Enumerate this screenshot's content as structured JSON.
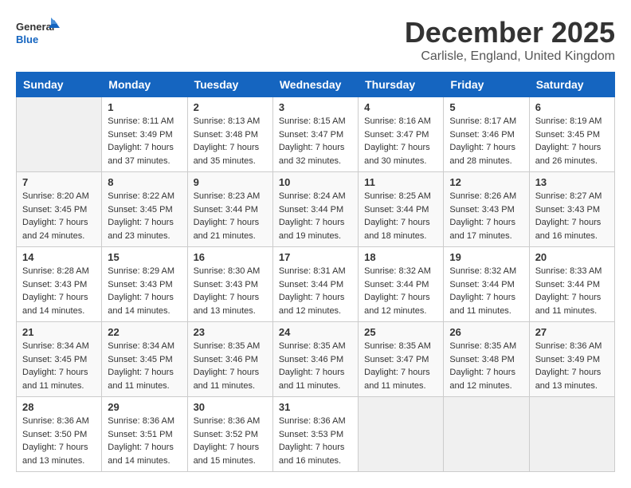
{
  "header": {
    "logo_general": "General",
    "logo_blue": "Blue",
    "month": "December 2025",
    "location": "Carlisle, England, United Kingdom"
  },
  "weekdays": [
    "Sunday",
    "Monday",
    "Tuesday",
    "Wednesday",
    "Thursday",
    "Friday",
    "Saturday"
  ],
  "weeks": [
    [
      {
        "day": "",
        "sunrise": "",
        "sunset": "",
        "daylight": ""
      },
      {
        "day": "1",
        "sunrise": "Sunrise: 8:11 AM",
        "sunset": "Sunset: 3:49 PM",
        "daylight": "Daylight: 7 hours and 37 minutes."
      },
      {
        "day": "2",
        "sunrise": "Sunrise: 8:13 AM",
        "sunset": "Sunset: 3:48 PM",
        "daylight": "Daylight: 7 hours and 35 minutes."
      },
      {
        "day": "3",
        "sunrise": "Sunrise: 8:15 AM",
        "sunset": "Sunset: 3:47 PM",
        "daylight": "Daylight: 7 hours and 32 minutes."
      },
      {
        "day": "4",
        "sunrise": "Sunrise: 8:16 AM",
        "sunset": "Sunset: 3:47 PM",
        "daylight": "Daylight: 7 hours and 30 minutes."
      },
      {
        "day": "5",
        "sunrise": "Sunrise: 8:17 AM",
        "sunset": "Sunset: 3:46 PM",
        "daylight": "Daylight: 7 hours and 28 minutes."
      },
      {
        "day": "6",
        "sunrise": "Sunrise: 8:19 AM",
        "sunset": "Sunset: 3:45 PM",
        "daylight": "Daylight: 7 hours and 26 minutes."
      }
    ],
    [
      {
        "day": "7",
        "sunrise": "Sunrise: 8:20 AM",
        "sunset": "Sunset: 3:45 PM",
        "daylight": "Daylight: 7 hours and 24 minutes."
      },
      {
        "day": "8",
        "sunrise": "Sunrise: 8:22 AM",
        "sunset": "Sunset: 3:45 PM",
        "daylight": "Daylight: 7 hours and 23 minutes."
      },
      {
        "day": "9",
        "sunrise": "Sunrise: 8:23 AM",
        "sunset": "Sunset: 3:44 PM",
        "daylight": "Daylight: 7 hours and 21 minutes."
      },
      {
        "day": "10",
        "sunrise": "Sunrise: 8:24 AM",
        "sunset": "Sunset: 3:44 PM",
        "daylight": "Daylight: 7 hours and 19 minutes."
      },
      {
        "day": "11",
        "sunrise": "Sunrise: 8:25 AM",
        "sunset": "Sunset: 3:44 PM",
        "daylight": "Daylight: 7 hours and 18 minutes."
      },
      {
        "day": "12",
        "sunrise": "Sunrise: 8:26 AM",
        "sunset": "Sunset: 3:43 PM",
        "daylight": "Daylight: 7 hours and 17 minutes."
      },
      {
        "day": "13",
        "sunrise": "Sunrise: 8:27 AM",
        "sunset": "Sunset: 3:43 PM",
        "daylight": "Daylight: 7 hours and 16 minutes."
      }
    ],
    [
      {
        "day": "14",
        "sunrise": "Sunrise: 8:28 AM",
        "sunset": "Sunset: 3:43 PM",
        "daylight": "Daylight: 7 hours and 14 minutes."
      },
      {
        "day": "15",
        "sunrise": "Sunrise: 8:29 AM",
        "sunset": "Sunset: 3:43 PM",
        "daylight": "Daylight: 7 hours and 14 minutes."
      },
      {
        "day": "16",
        "sunrise": "Sunrise: 8:30 AM",
        "sunset": "Sunset: 3:43 PM",
        "daylight": "Daylight: 7 hours and 13 minutes."
      },
      {
        "day": "17",
        "sunrise": "Sunrise: 8:31 AM",
        "sunset": "Sunset: 3:44 PM",
        "daylight": "Daylight: 7 hours and 12 minutes."
      },
      {
        "day": "18",
        "sunrise": "Sunrise: 8:32 AM",
        "sunset": "Sunset: 3:44 PM",
        "daylight": "Daylight: 7 hours and 12 minutes."
      },
      {
        "day": "19",
        "sunrise": "Sunrise: 8:32 AM",
        "sunset": "Sunset: 3:44 PM",
        "daylight": "Daylight: 7 hours and 11 minutes."
      },
      {
        "day": "20",
        "sunrise": "Sunrise: 8:33 AM",
        "sunset": "Sunset: 3:44 PM",
        "daylight": "Daylight: 7 hours and 11 minutes."
      }
    ],
    [
      {
        "day": "21",
        "sunrise": "Sunrise: 8:34 AM",
        "sunset": "Sunset: 3:45 PM",
        "daylight": "Daylight: 7 hours and 11 minutes."
      },
      {
        "day": "22",
        "sunrise": "Sunrise: 8:34 AM",
        "sunset": "Sunset: 3:45 PM",
        "daylight": "Daylight: 7 hours and 11 minutes."
      },
      {
        "day": "23",
        "sunrise": "Sunrise: 8:35 AM",
        "sunset": "Sunset: 3:46 PM",
        "daylight": "Daylight: 7 hours and 11 minutes."
      },
      {
        "day": "24",
        "sunrise": "Sunrise: 8:35 AM",
        "sunset": "Sunset: 3:46 PM",
        "daylight": "Daylight: 7 hours and 11 minutes."
      },
      {
        "day": "25",
        "sunrise": "Sunrise: 8:35 AM",
        "sunset": "Sunset: 3:47 PM",
        "daylight": "Daylight: 7 hours and 11 minutes."
      },
      {
        "day": "26",
        "sunrise": "Sunrise: 8:35 AM",
        "sunset": "Sunset: 3:48 PM",
        "daylight": "Daylight: 7 hours and 12 minutes."
      },
      {
        "day": "27",
        "sunrise": "Sunrise: 8:36 AM",
        "sunset": "Sunset: 3:49 PM",
        "daylight": "Daylight: 7 hours and 13 minutes."
      }
    ],
    [
      {
        "day": "28",
        "sunrise": "Sunrise: 8:36 AM",
        "sunset": "Sunset: 3:50 PM",
        "daylight": "Daylight: 7 hours and 13 minutes."
      },
      {
        "day": "29",
        "sunrise": "Sunrise: 8:36 AM",
        "sunset": "Sunset: 3:51 PM",
        "daylight": "Daylight: 7 hours and 14 minutes."
      },
      {
        "day": "30",
        "sunrise": "Sunrise: 8:36 AM",
        "sunset": "Sunset: 3:52 PM",
        "daylight": "Daylight: 7 hours and 15 minutes."
      },
      {
        "day": "31",
        "sunrise": "Sunrise: 8:36 AM",
        "sunset": "Sunset: 3:53 PM",
        "daylight": "Daylight: 7 hours and 16 minutes."
      },
      {
        "day": "",
        "sunrise": "",
        "sunset": "",
        "daylight": ""
      },
      {
        "day": "",
        "sunrise": "",
        "sunset": "",
        "daylight": ""
      },
      {
        "day": "",
        "sunrise": "",
        "sunset": "",
        "daylight": ""
      }
    ]
  ]
}
